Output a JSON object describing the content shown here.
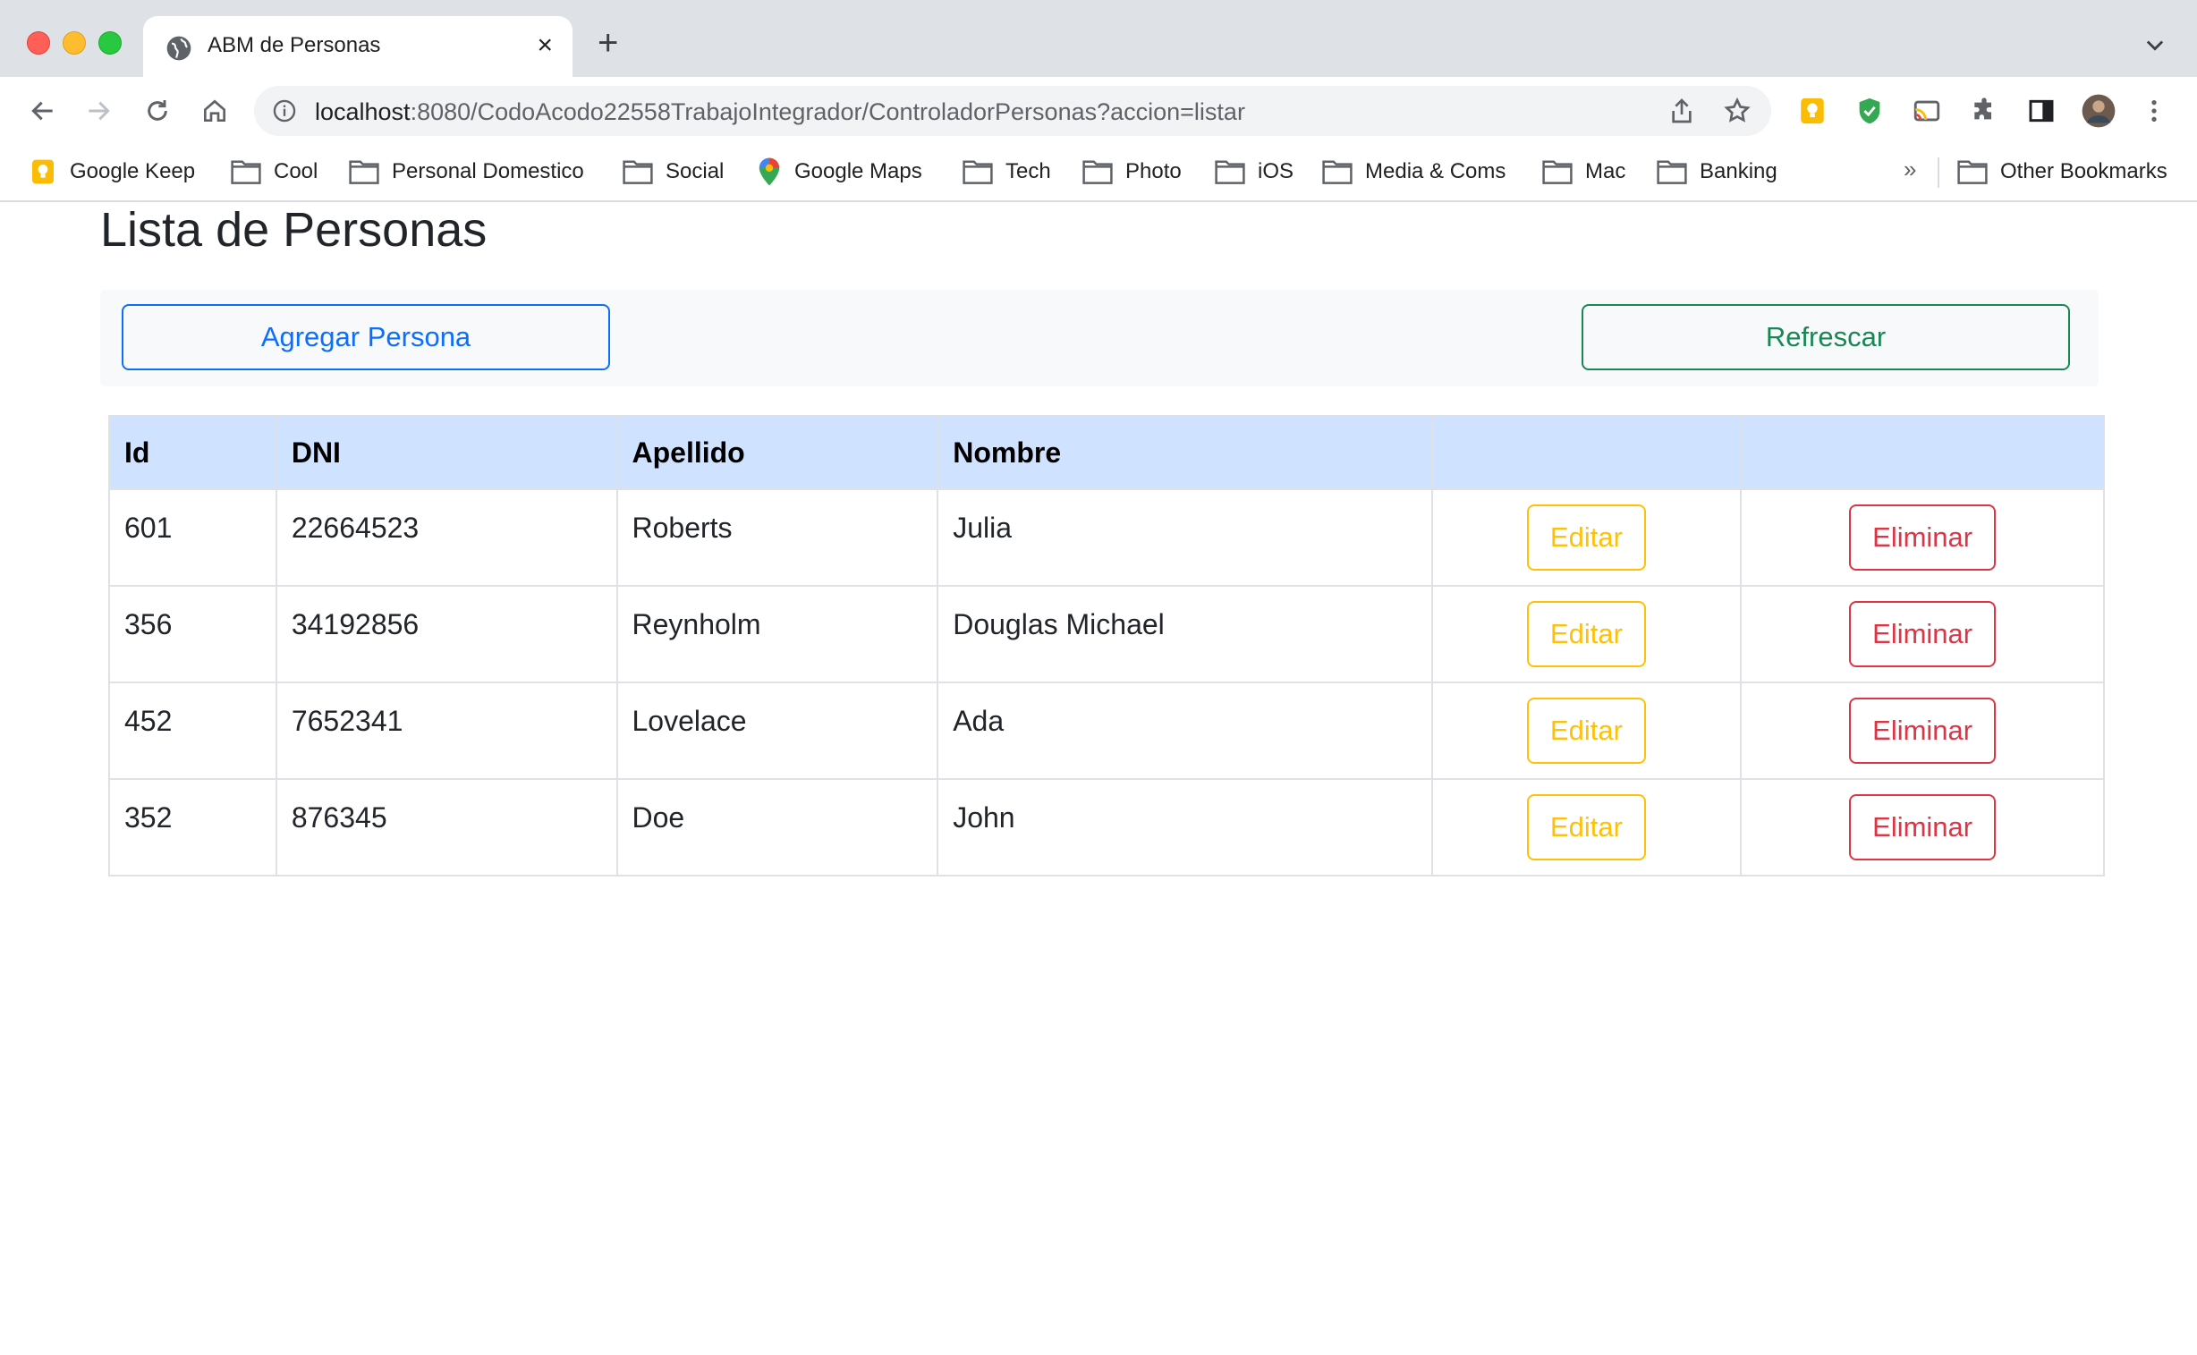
{
  "browser": {
    "tab": {
      "title": "ABM de Personas",
      "favicon": "globe-icon",
      "close": "×"
    },
    "new_tab": "+",
    "address": {
      "host": "localhost",
      "path": ":8080/CodoAcodo22558TrabajoIntegrador/ControladorPersonas?accion=listar"
    },
    "bookmarks": [
      {
        "label": "Google Keep",
        "icon": "keep-icon"
      },
      {
        "label": "Cool",
        "icon": "folder-icon"
      },
      {
        "label": "Personal Domestico",
        "icon": "folder-icon"
      },
      {
        "label": "Social",
        "icon": "folder-icon"
      },
      {
        "label": "Google Maps",
        "icon": "maps-pin-icon"
      },
      {
        "label": "Tech",
        "icon": "folder-icon"
      },
      {
        "label": "Photo",
        "icon": "folder-icon"
      },
      {
        "label": "iOS",
        "icon": "folder-icon"
      },
      {
        "label": "Media & Coms",
        "icon": "folder-icon"
      },
      {
        "label": "Mac",
        "icon": "folder-icon"
      },
      {
        "label": "Banking",
        "icon": "folder-icon"
      }
    ],
    "bookmarks_more": "»",
    "other_bookmarks": "Other Bookmarks"
  },
  "page": {
    "title": "Lista de Personas",
    "add_button": "Agregar Persona",
    "refresh_button": "Refrescar",
    "table": {
      "headers": [
        "Id",
        "DNI",
        "Apellido",
        "Nombre",
        "",
        ""
      ],
      "rows": [
        {
          "id": "601",
          "dni": "22664523",
          "apellido": "Roberts",
          "nombre": "Julia"
        },
        {
          "id": "356",
          "dni": "34192856",
          "apellido": "Reynholm",
          "nombre": "Douglas Michael"
        },
        {
          "id": "452",
          "dni": "7652341",
          "apellido": "Lovelace",
          "nombre": "Ada"
        },
        {
          "id": "352",
          "dni": "876345",
          "apellido": "Doe",
          "nombre": "John"
        }
      ],
      "edit_label": "Editar",
      "delete_label": "Eliminar"
    }
  },
  "colors": {
    "primary": "#0d6efd",
    "success": "#198754",
    "warning": "#ffc107",
    "danger": "#dc3545",
    "table_header": "#cfe2ff"
  }
}
